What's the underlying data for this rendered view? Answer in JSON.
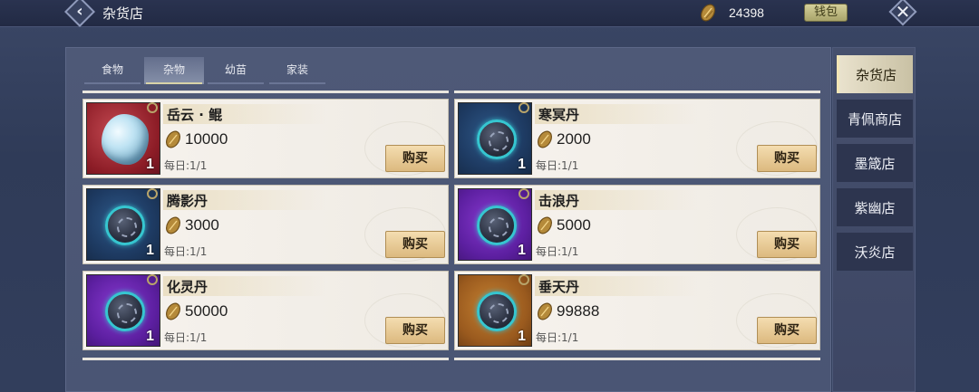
{
  "header": {
    "title": "杂货店",
    "currency_amount": "24398",
    "wallet_label": "钱包"
  },
  "tabs": [
    {
      "label": "食物",
      "active": false
    },
    {
      "label": "杂物",
      "active": true
    },
    {
      "label": "幼苗",
      "active": false
    },
    {
      "label": "家装",
      "active": false
    }
  ],
  "items": [
    {
      "name": "岳云 · 鲲",
      "price": "10000",
      "limit": "每日:1/1",
      "count": "1",
      "buy_label": "购买",
      "frame": "red",
      "icon": "crystal-icon"
    },
    {
      "name": "寒冥丹",
      "price": "2000",
      "limit": "每日:1/1",
      "count": "1",
      "buy_label": "购买",
      "frame": "blue",
      "icon": "pill-icon"
    },
    {
      "name": "腾影丹",
      "price": "3000",
      "limit": "每日:1/1",
      "count": "1",
      "buy_label": "购买",
      "frame": "blue",
      "icon": "pill-icon"
    },
    {
      "name": "击浪丹",
      "price": "5000",
      "limit": "每日:1/1",
      "count": "1",
      "buy_label": "购买",
      "frame": "purple",
      "icon": "pill-icon"
    },
    {
      "name": "化灵丹",
      "price": "50000",
      "limit": "每日:1/1",
      "count": "1",
      "buy_label": "购买",
      "frame": "purple",
      "icon": "pill-icon"
    },
    {
      "name": "垂天丹",
      "price": "99888",
      "limit": "每日:1/1",
      "count": "1",
      "buy_label": "购买",
      "frame": "orange",
      "icon": "pill-icon"
    }
  ],
  "sidebar": [
    {
      "label": "杂货店",
      "active": true
    },
    {
      "label": "青佩商店",
      "active": false
    },
    {
      "label": "墨箴店",
      "active": false
    },
    {
      "label": "紫幽店",
      "active": false
    },
    {
      "label": "沃炎店",
      "active": false
    }
  ]
}
